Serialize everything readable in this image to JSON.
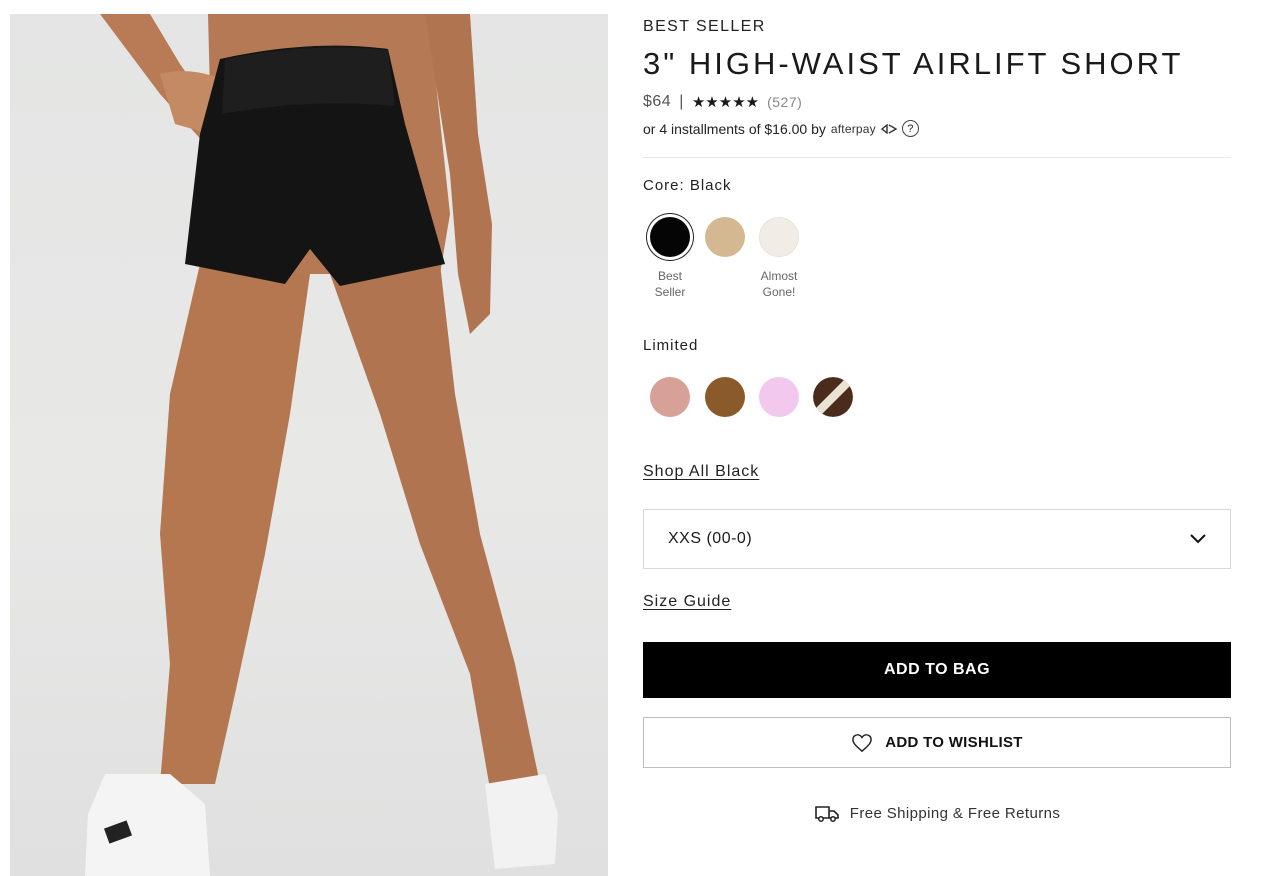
{
  "product": {
    "eyebrow": "BEST SELLER",
    "title": "3\" HIGH-WAIST AIRLIFT SHORT",
    "price": "$64",
    "price_separator": "|",
    "rating_stars": "★★★★★",
    "rating": 4.5,
    "review_count": "(527)",
    "afterpay_text": "or 4 installments of $16.00 by",
    "afterpay_logo": "afterpay",
    "afterpay_help": "?"
  },
  "colors": {
    "selected_label": "Core: Black",
    "core": [
      {
        "name": "Black",
        "hex": "#050505",
        "note_line1": "Best",
        "note_line2": "Seller",
        "selected": true
      },
      {
        "name": "Tan",
        "hex": "#d4b892",
        "note_line1": "",
        "note_line2": ""
      },
      {
        "name": "Ivory",
        "hex": "#f1ede6",
        "note_line1": "Almost",
        "note_line2": "Gone!"
      }
    ],
    "limited_label": "Limited",
    "limited": [
      {
        "name": "Rose",
        "hex": "#d7a198"
      },
      {
        "name": "Brown",
        "hex": "#8b5a2b"
      },
      {
        "name": "Pink",
        "hex": "#f3c8ee"
      },
      {
        "name": "Espresso Stripe",
        "hex": "#4a2c1d"
      }
    ]
  },
  "links": {
    "shop_all": "Shop All Black",
    "size_guide": "Size Guide"
  },
  "size": {
    "selected": "XXS (00-0)"
  },
  "actions": {
    "add_to_bag": "ADD TO BAG",
    "add_to_wishlist": "ADD TO WISHLIST"
  },
  "shipping": {
    "text": "Free Shipping & Free Returns"
  }
}
